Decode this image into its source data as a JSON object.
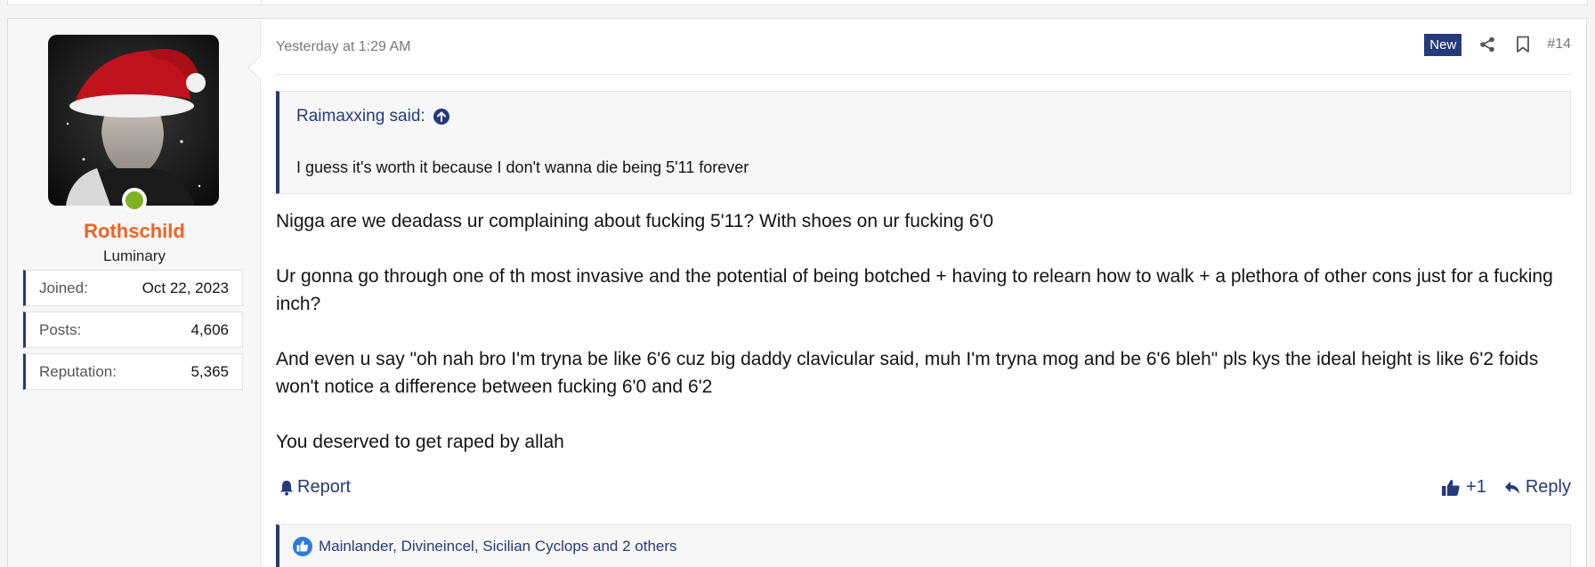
{
  "post": {
    "date": "Yesterday at 1:29 AM",
    "badge": "New",
    "number": "#14",
    "icons": {
      "share": "share-icon",
      "bookmark": "bookmark-icon"
    }
  },
  "user": {
    "name": "Rothschild",
    "title": "Luminary",
    "online": true,
    "stats": [
      {
        "label": "Joined:",
        "value": "Oct 22, 2023"
      },
      {
        "label": "Posts:",
        "value": "4,606"
      },
      {
        "label": "Reputation:",
        "value": "5,365"
      }
    ]
  },
  "quote": {
    "author": "Raimaxxing said:",
    "text": "I guess it's worth it because I don't wanna die being 5'11 forever"
  },
  "body": {
    "p1": "Nigga are we deadass ur complaining about fucking 5'11? With shoes on ur fucking 6'0",
    "p2": "Ur gonna go through one of th most invasive and the potential of being botched + having to relearn how to walk + a plethora of other cons just for a fucking inch?",
    "p3": "And even u say \"oh nah bro I'm tryna be like 6'6 cuz big daddy clavicular said, muh I'm tryna mog and be 6'6 bleh\" pls kys the ideal height is like 6'2 foids won't notice a difference between fucking 6'0 and 6'2",
    "p4": "You deserved to get raped by allah"
  },
  "footer": {
    "report": "Report",
    "likes": "+1",
    "reply": "Reply"
  },
  "reactions": {
    "text": "Mainlander, Divineincel, Sicilian Cyclops and 2 others"
  },
  "colors": {
    "accent": "#253a7a",
    "username": "#f26322",
    "online": "#7db321"
  }
}
